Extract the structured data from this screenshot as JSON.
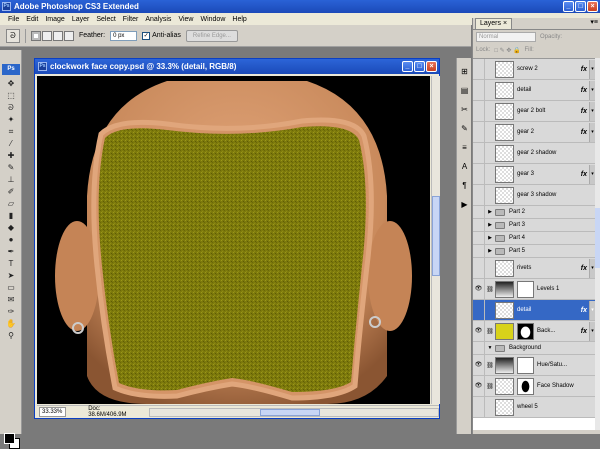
{
  "app": {
    "title": "Adobe Photoshop CS3 Extended"
  },
  "menu": [
    "File",
    "Edit",
    "Image",
    "Layer",
    "Select",
    "Filter",
    "Analysis",
    "View",
    "Window",
    "Help"
  ],
  "options": {
    "feather_label": "Feather:",
    "feather_value": "0 px",
    "antialias_label": "Anti-alias",
    "refine_label": "Refine Edge..."
  },
  "document": {
    "title": "clockwork face copy.psd @ 33.3% (detail, RGB/8)",
    "zoom": "33.33%",
    "doc_size": "Doc: 38.6M/406.9M"
  },
  "colors": {
    "face_fill": "#7d7a0c",
    "skin": "#c98a5c",
    "accent": "#3568c5"
  },
  "layers_panel": {
    "tab": "Layers ×",
    "blend_mode": "Normal",
    "opacity_label": "Opacity:",
    "lock_label": "Lock:",
    "fill_label": "Fill:",
    "items": [
      {
        "kind": "layer",
        "name": "screw 2",
        "fx": true,
        "thumb": "check"
      },
      {
        "kind": "layer",
        "name": "detail",
        "fx": true,
        "thumb": "check"
      },
      {
        "kind": "layer",
        "name": "gear 2 bolt",
        "fx": true,
        "thumb": "check"
      },
      {
        "kind": "layer",
        "name": "gear 2",
        "fx": true,
        "thumb": "check"
      },
      {
        "kind": "layer",
        "name": "gear 2 shadow",
        "fx": false,
        "thumb": "check"
      },
      {
        "kind": "layer",
        "name": "gear 3",
        "fx": true,
        "thumb": "check"
      },
      {
        "kind": "layer",
        "name": "gear 3 shadow",
        "fx": false,
        "thumb": "check"
      },
      {
        "kind": "group",
        "name": "Part 2"
      },
      {
        "kind": "group",
        "name": "Part 3"
      },
      {
        "kind": "group",
        "name": "Part 4"
      },
      {
        "kind": "group",
        "name": "Part 5"
      },
      {
        "kind": "layer",
        "name": "rivets",
        "fx": true,
        "thumb": "check"
      },
      {
        "kind": "layer",
        "name": "Levels 1",
        "fx": false,
        "thumb": "grad",
        "mask": "white"
      },
      {
        "kind": "layer",
        "name": "detail",
        "fx": true,
        "thumb": "check",
        "selected": true
      },
      {
        "kind": "layer",
        "name": "Back...",
        "fx": true,
        "thumb": "yellow",
        "mask": "black"
      },
      {
        "kind": "group",
        "name": "Background",
        "open": true
      },
      {
        "kind": "layer",
        "name": "Hue/Satu...",
        "fx": false,
        "thumb": "grad",
        "mask": "white"
      },
      {
        "kind": "layer",
        "name": "Face Shadow",
        "fx": false,
        "thumb": "check",
        "mask": "face"
      },
      {
        "kind": "layer",
        "name": "wheel 5",
        "fx": false,
        "thumb": "check"
      }
    ]
  }
}
